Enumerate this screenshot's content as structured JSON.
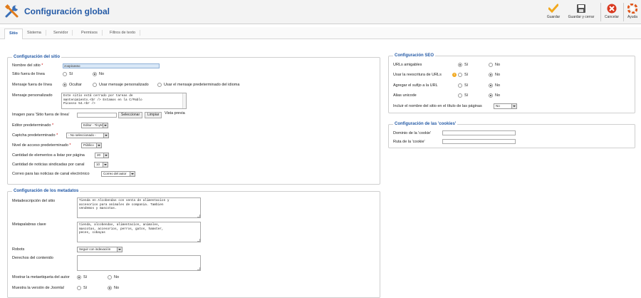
{
  "header": {
    "title": "Configuración global",
    "toolbar": {
      "save": "Guardar",
      "save_close": "Guardar y cerrar",
      "cancel": "Cancelar",
      "help": "Ayuda"
    }
  },
  "tabs": [
    "Sitio",
    "Sistema",
    "Servidor",
    "Permisos",
    "Filtros de texto"
  ],
  "site": {
    "legend": "Configuración del sitio",
    "site_name_label": "Nombre del sitio",
    "site_name_value": "zoopicasso",
    "offline_label": "Sitio fuera de línea",
    "opt_yes": "Sí",
    "opt_no": "No",
    "offline_msg_label": "Mensaje fuera de línea",
    "offline_msg_opts": [
      "Ocultar",
      "Usar mensaje personalizado",
      "Usar el mensaje predeterminado del idioma"
    ],
    "custom_msg_label": "Mensaje personalizado",
    "custom_msg_value": "Este sitio está cerrado por tareas de\nmantenimiento.<br /> Estamos en la C/Pablo\nPicasso 54.<br />",
    "offline_image_label": "Imagen para 'Sitio fuera de línea'",
    "select_btn": "Seleccionar",
    "clear_btn": "Limpiar",
    "preview_label": "Vista previa",
    "editor_label": "Editor predeterminado",
    "editor_value": "Editor - TinyMCE",
    "captcha_label": "Captcha predeterminado",
    "captcha_value": "- No seleccionado -",
    "access_label": "Nivel de acceso predeterminado",
    "access_value": "Público",
    "list_limit_label": "Cantidad de elementos a listar por página",
    "list_limit_value": "20",
    "feed_limit_label": "Cantidad de noticias sindicadas por canal",
    "feed_limit_value": "10",
    "feed_email_label": "Correo para las noticias de canal electrónico",
    "feed_email_value": "Correo del autor"
  },
  "metadata": {
    "legend": "Configuración de los metadatos",
    "desc_label": "Metadescripción del sitio",
    "desc_value": "Tienda en Alcobendas con venta de alimentacion y\naccesorios para animales de compania. Tambien\nvendemos y mascotas.",
    "keywords_label": "Metapalabras clave",
    "keywords_value": "tienda, alcobendas, alimentacion, animales,\nmascotas, accesorios, perros, gatos, hamster,\npeces, cobayas",
    "robots_label": "Robots",
    "robots_value": "Seguir con indexación",
    "rights_label": "Derechos del contenido",
    "rights_value": "",
    "show_author_label": "Mostrar la metaetiqueta del autor",
    "show_version_label": "Muestra la versión de Joomla!",
    "opt_yes": "Sí",
    "opt_no": "No"
  },
  "seo": {
    "legend": "Configuración SEO",
    "sef_label": "URLs amigables",
    "rewrite_label": "Usar la reescritura de URLs",
    "suffix_label": "Agregar el sufijo a la URL",
    "unicode_label": "Alias unicode",
    "sitename_title_label": "Incluir el nombre del sitio en el título de las páginas",
    "sitename_title_value": "No",
    "opt_yes": "Sí",
    "opt_no": "No"
  },
  "cookies": {
    "legend": "Configuración de las 'cookies'",
    "domain_label": "Dominio de la 'cookie'",
    "path_label": "Ruta de la 'cookie'"
  },
  "colors": {
    "accent": "#245aa6",
    "save": "#f2a81d",
    "cancel": "#d9381e",
    "help": "#e0571b"
  }
}
